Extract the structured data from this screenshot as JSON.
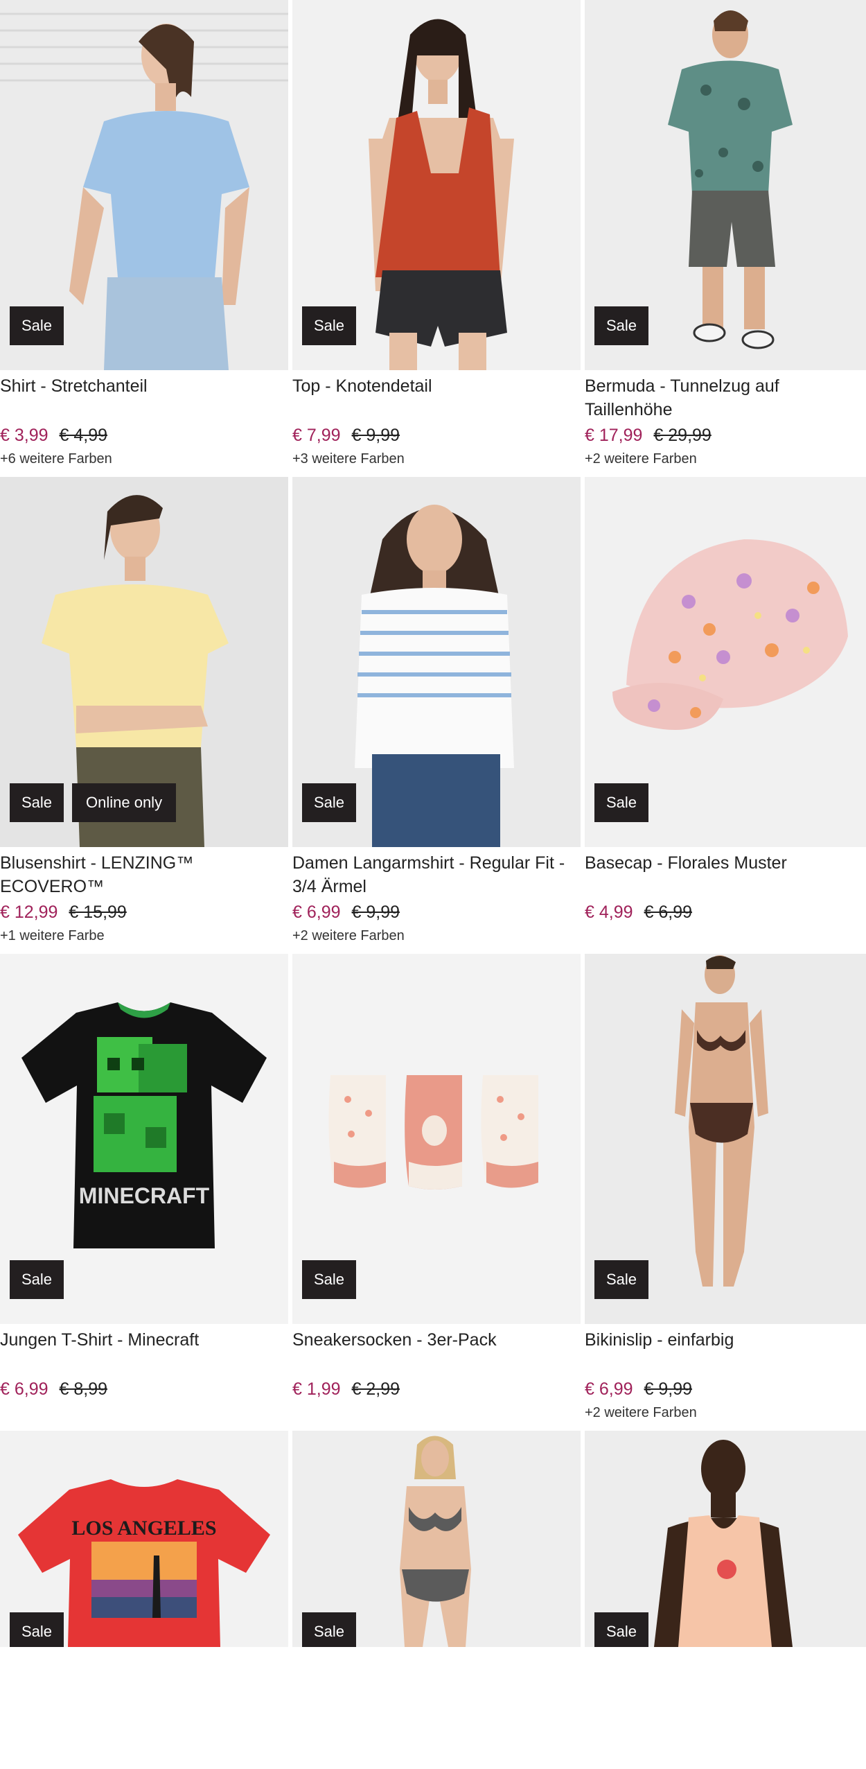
{
  "colors": {
    "sale_badge": "#231f20",
    "price_sale": "#a0225a"
  },
  "products": [
    {
      "title": "Shirt - Stretchanteil",
      "price": "€ 3,99",
      "old_price": "€ 4,99",
      "badges": [
        "Sale"
      ],
      "colors_text": "+6 weitere Farben",
      "image": "woman-blue-tshirt"
    },
    {
      "title": "Top - Knotendetail",
      "price": "€ 7,99",
      "old_price": "€ 9,99",
      "badges": [
        "Sale"
      ],
      "colors_text": "+3 weitere Farben",
      "image": "woman-red-top"
    },
    {
      "title": "Bermuda - Tunnelzug auf Taillenhöhe",
      "price": "€ 17,99",
      "old_price": "€ 29,99",
      "badges": [
        "Sale"
      ],
      "colors_text": "+2 weitere Farben",
      "image": "man-bermuda"
    },
    {
      "title": "Blusenshirt - LENZING™ ECOVERO™",
      "price": "€ 12,99",
      "old_price": "€ 15,99",
      "badges": [
        "Sale",
        "Online only"
      ],
      "colors_text": "+1 weitere Farbe",
      "image": "woman-yellow-blouse"
    },
    {
      "title": "Damen Langarmshirt - Regular Fit - 3/4 Ärmel",
      "price": "€ 6,99",
      "old_price": "€ 9,99",
      "badges": [
        "Sale"
      ],
      "colors_text": "+2 weitere Farben",
      "image": "woman-striped-shirt"
    },
    {
      "title": "Basecap - Florales Muster",
      "price": "€ 4,99",
      "old_price": "€ 6,99",
      "badges": [
        "Sale"
      ],
      "colors_text": "",
      "image": "floral-cap"
    },
    {
      "title": "Jungen T-Shirt - Minecraft",
      "price": "€ 6,99",
      "old_price": "€ 8,99",
      "badges": [
        "Sale"
      ],
      "colors_text": "",
      "image": "minecraft-tshirt"
    },
    {
      "title": "Sneakersocken - 3er-Pack",
      "price": "€ 1,99",
      "old_price": "€ 2,99",
      "badges": [
        "Sale"
      ],
      "colors_text": "",
      "image": "socks-3pack"
    },
    {
      "title": "Bikinislip - einfarbig",
      "price": "€ 6,99",
      "old_price": "€ 9,99",
      "badges": [
        "Sale"
      ],
      "colors_text": "+2 weitere Farben",
      "image": "woman-brown-bikini"
    },
    {
      "title": "",
      "price": "",
      "old_price": "",
      "badges": [
        "Sale"
      ],
      "colors_text": "",
      "image": "los-angeles-tshirt"
    },
    {
      "title": "",
      "price": "",
      "old_price": "",
      "badges": [
        "Sale"
      ],
      "colors_text": "",
      "image": "woman-gingham-bikini"
    },
    {
      "title": "",
      "price": "",
      "old_price": "",
      "badges": [
        "Sale"
      ],
      "colors_text": "",
      "image": "man-peach-tanktop"
    }
  ],
  "graphic_text": {
    "minecraft": "MINECRAFT",
    "los_angeles": "LOS ANGELES"
  }
}
